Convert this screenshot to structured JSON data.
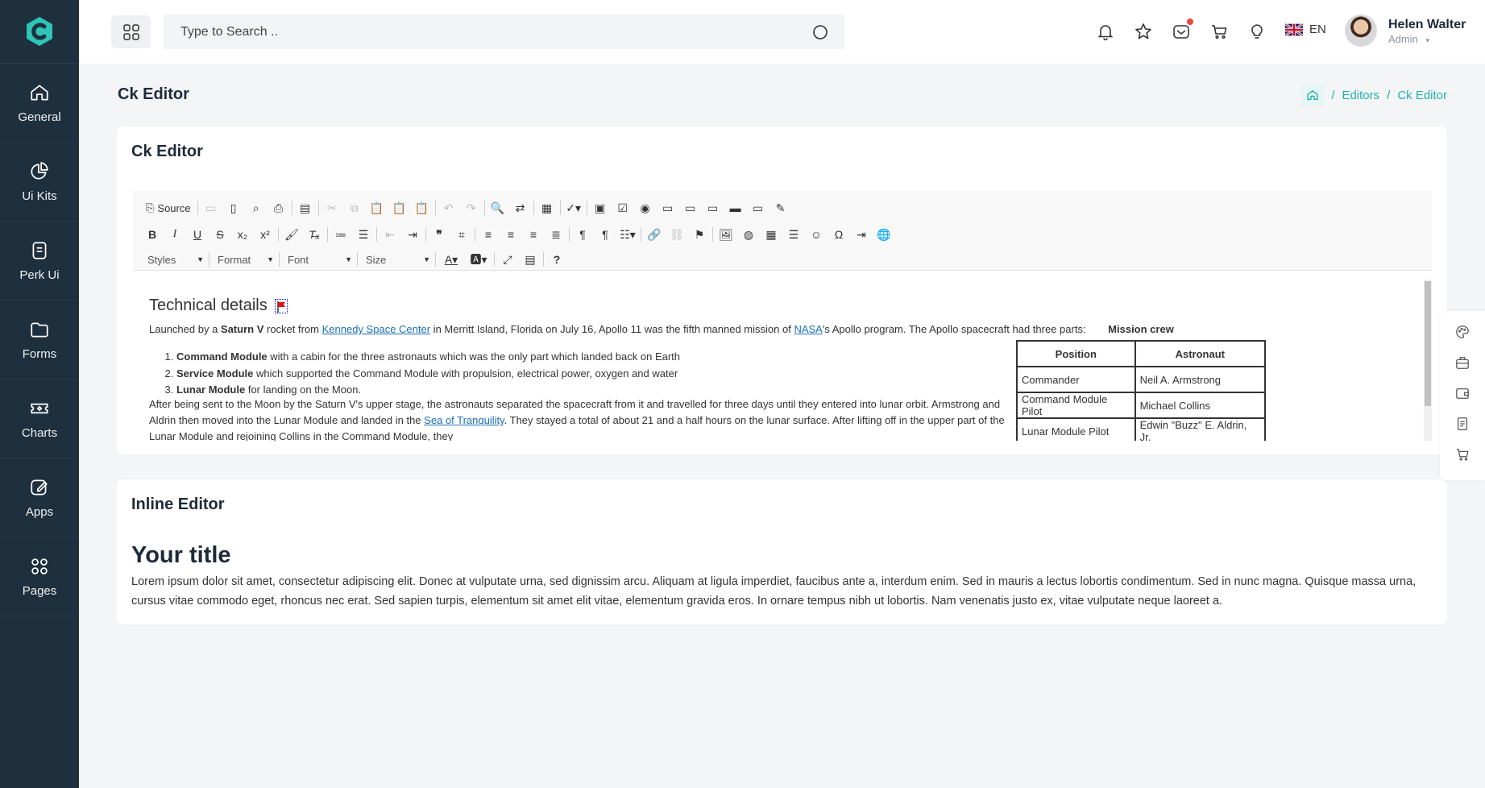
{
  "sidebar": {
    "items": [
      {
        "label": "General"
      },
      {
        "label": "Ui Kits"
      },
      {
        "label": "Perk Ui"
      },
      {
        "label": "Forms"
      },
      {
        "label": "Charts"
      },
      {
        "label": "Apps"
      },
      {
        "label": "Pages"
      }
    ]
  },
  "header": {
    "search_placeholder": "Type to Search ..",
    "language": "EN",
    "user_name": "Helen Walter",
    "user_role": "Admin"
  },
  "page": {
    "title": "Ck Editor",
    "breadcrumb": [
      "Editors",
      "Ck Editor"
    ]
  },
  "ck_card": {
    "title": "Ck Editor",
    "toolbar": {
      "source_label": "Source",
      "styles_label": "Styles",
      "format_label": "Format",
      "font_label": "Font",
      "size_label": "Size"
    },
    "content": {
      "heading": "Technical details",
      "intro_1": "Launched by a ",
      "intro_bold": "Saturn V",
      "intro_2": " rocket from ",
      "intro_link1": "Kennedy Space Center",
      "intro_3": " in Merritt Island, Florida on July 16, Apollo 11 was the fifth manned mission of ",
      "intro_link2": "NASA",
      "intro_4": "'s Apollo program. The Apollo spacecraft had three parts:",
      "list": [
        {
          "bold": "Command Module",
          "text": " with a cabin for the three astronauts which was the only part which landed back on Earth"
        },
        {
          "bold": "Service Module",
          "text": " which supported the Command Module with propulsion, electrical power, oxygen and water"
        },
        {
          "bold": "Lunar Module",
          "text": " for landing on the Moon."
        }
      ],
      "para2_a": "After being sent to the Moon by the Saturn V's upper stage, the astronauts separated the spacecraft from it and travelled for three days until they entered into lunar orbit. Armstrong and Aldrin then moved into the Lunar",
      "para2_b1": "Module and landed in the ",
      "para2_link": "Sea of Tranquility",
      "para2_b2": ". They stayed a total of about 21 and a half hours on the lunar surface. After lifting off in the upper part of the Lunar Module and rejoining Collins in the Command Module, they",
      "table_caption": "Mission crew",
      "table_headers": [
        "Position",
        "Astronaut"
      ],
      "table_rows": [
        [
          "Commander",
          "Neil A. Armstrong"
        ],
        [
          "Command Module Pilot",
          "Michael Collins"
        ],
        [
          "Lunar Module Pilot",
          "Edwin \"Buzz\" E. Aldrin, Jr."
        ]
      ]
    }
  },
  "inline_card": {
    "title": "Inline Editor",
    "heading": "Your title",
    "body": "Lorem ipsum dolor sit amet, consectetur adipiscing elit. Donec at vulputate urna, sed dignissim arcu. Aliquam at ligula imperdiet, faucibus ante a, interdum enim. Sed in mauris a lectus lobortis condimentum. Sed in nunc magna. Quisque massa urna, cursus vitae commodo eget, rhoncus nec erat. Sed sapien turpis, elementum sit amet elit vitae, elementum gravida eros. In ornare tempus nibh ut lobortis. Nam venenatis justo ex, vitae vulputate neque laoreet a."
  },
  "colors": {
    "sidebar_bg": "#1e2f3d",
    "accent": "#20b2aa",
    "page_bg": "#f4f5f7"
  }
}
